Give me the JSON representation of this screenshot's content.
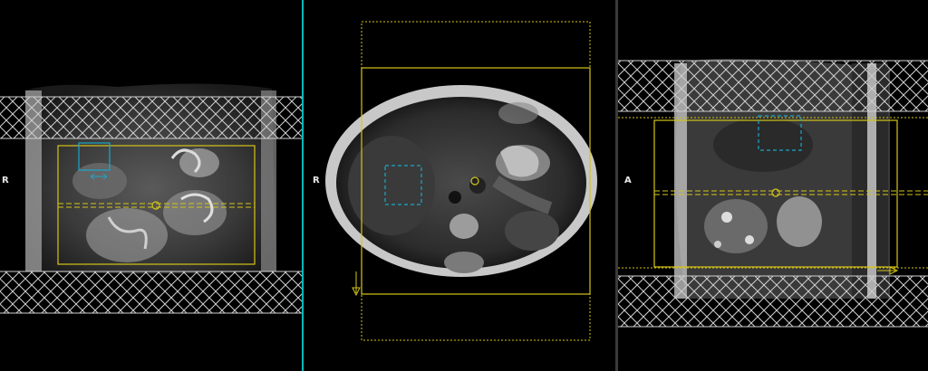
{
  "viewports": [
    {
      "id": "coronal",
      "orientation_label": "R"
    },
    {
      "id": "axial",
      "orientation_label": "R"
    },
    {
      "id": "sagittal",
      "orientation_label": "A"
    }
  ],
  "colors": {
    "planning_box": "#d4c418",
    "shim_box": "#1aa7c8",
    "saturation_hatch": "#cfcfcf",
    "active_divider": "#00b8b8",
    "label": "#e8e8e8"
  }
}
